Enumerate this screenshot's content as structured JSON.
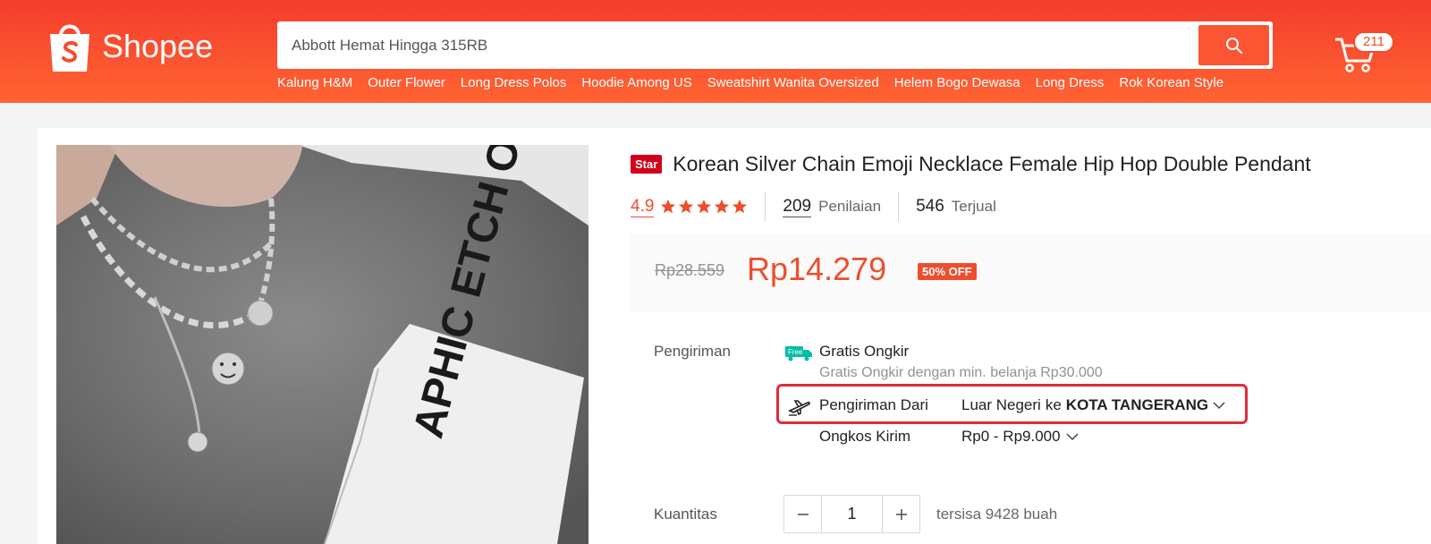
{
  "header": {
    "logo_text": "Shopee",
    "search_placeholder": "Abbott Hemat Hingga 315RB",
    "quick_links": [
      "Kalung H&M",
      "Outer Flower",
      "Long Dress Polos",
      "Hoodie Among US",
      "Sweatshirt Wanita Oversized",
      "Helem Bogo Dewasa",
      "Long Dress",
      "Rok Korean Style"
    ],
    "cart_count": "211"
  },
  "product": {
    "badge": "Star",
    "title": "Korean Silver Chain Emoji Necklace Female Hip Hop Double Pendant",
    "rating": "4.9",
    "stars": 5,
    "reviews_count": "209",
    "reviews_label": "Penilaian",
    "sold_count": "546",
    "sold_label": "Terjual",
    "old_price": "Rp28.559",
    "price": "Rp14.279",
    "discount": "50% OFF",
    "photo_text": "APHIC ETCH OOK"
  },
  "shipping": {
    "label": "Pengiriman",
    "free_icon_text": "Free",
    "free_title": "Gratis Ongkir",
    "free_subtitle": "Gratis Ongkir dengan min. belanja Rp30.000",
    "from_label": "Pengiriman Dari",
    "from_origin": "Luar Negeri",
    "from_connector": "ke",
    "from_destination": "KOTA TANGERANG",
    "cost_label": "Ongkos Kirim",
    "cost_value": "Rp0 - Rp9.000"
  },
  "quantity": {
    "label": "Kuantitas",
    "value": "1",
    "stock": "tersisa 9428 buah"
  },
  "colors": {
    "brand": "#ee4d2d",
    "highlight_border": "#e02b3a"
  }
}
